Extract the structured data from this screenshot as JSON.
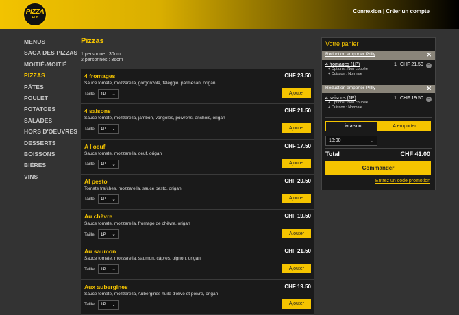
{
  "brand": {
    "logo_top": "PIZZA",
    "logo_bottom": "FLY"
  },
  "auth": {
    "login": "Connexion",
    "separator": "|",
    "signup": "Créer un compte"
  },
  "nav": [
    {
      "label": "MENUS"
    },
    {
      "label": "SAGA DES PIZZAS"
    },
    {
      "label": "MOITIÉ-MOITIÉ"
    },
    {
      "label": "PIZZAS",
      "active": true
    },
    {
      "label": "PÂTES"
    },
    {
      "label": "POULET"
    },
    {
      "label": "POTATOES"
    },
    {
      "label": "SALADES"
    },
    {
      "label": "HORS D'OEUVRES"
    },
    {
      "label": "DESSERTS"
    },
    {
      "label": "BOISSONS"
    },
    {
      "label": "BIÈRES"
    },
    {
      "label": "VINS"
    }
  ],
  "page": {
    "title": "Pizzas",
    "portion_1": "1 personne : 30cm",
    "portion_2": "2 personnes : 36cm",
    "size_label": "Taille",
    "size_value": "1P",
    "add_label": "Ajouter"
  },
  "items": [
    {
      "name": "4 fromages",
      "price": "CHF 23.50",
      "desc": "Sauce tomate, mozzarella, gorgonzola, taleggio, parmesan, origan"
    },
    {
      "name": "4 saisons",
      "price": "CHF 21.50",
      "desc": "Sauce tomate, mozzarella, jambon, vongoles, poivrons, anchois, origan"
    },
    {
      "name": "A l'oeuf",
      "price": "CHF 17.50",
      "desc": "Sauce tomate, mozzarella, oeuf, origan"
    },
    {
      "name": "Al pesto",
      "price": "CHF 20.50",
      "desc": "Tomate fraîches, mozzarella, sauce pesto, origan"
    },
    {
      "name": "Au chèvre",
      "price": "CHF 19.50",
      "desc": "Sauce tomate, mozzarella, fromage de chèvre, origan"
    },
    {
      "name": "Au saumon",
      "price": "CHF 21.50",
      "desc": "Sauce tomate, mozzarella, saumon, câpres, oignon, origan"
    },
    {
      "name": "Aux aubergines",
      "price": "CHF 19.50",
      "desc": "Sauce tomate, mozzarella, Aubergines huile d'olive et poivre, origan"
    }
  ],
  "cart": {
    "title": "Votre panier",
    "promo_label": "Reduction emporter Prilly",
    "lines": [
      {
        "name": "4 fromages (1P)",
        "qty": "1",
        "price": "CHF 21.50",
        "opt1": "+ Options : Non coupée",
        "opt2": "+ Cuisson : Normale"
      },
      {
        "name": "4 saisons (1P)",
        "qty": "1",
        "price": "CHF 19.50",
        "opt1": "+ Options : Non coupée",
        "opt2": "+ Cuisson : Normale"
      }
    ],
    "delivery_label": "Livraison",
    "takeaway_label": "A emporter",
    "time_value": "18:00",
    "total_label": "Total",
    "total_value": "CHF 41.00",
    "order_label": "Commander",
    "promo_code_link": "Entrez un code promotion"
  },
  "colors": {
    "accent": "#f5c400",
    "bg": "#333333",
    "panel": "#1a1a1a"
  }
}
